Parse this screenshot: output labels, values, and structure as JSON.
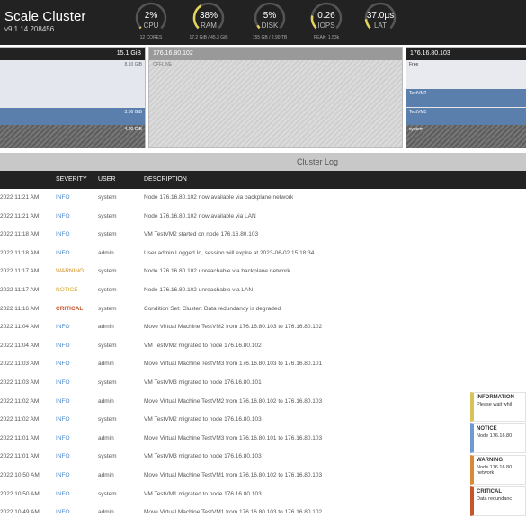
{
  "header": {
    "title": "Scale Cluster",
    "version": "v9.1.14.208456"
  },
  "gauges": [
    {
      "value": "2%",
      "label": "CPU",
      "sub": "12 CORES",
      "fraction": 0.02
    },
    {
      "value": "38%",
      "label": "RAM",
      "sub": "17.2 GiB / 45.3 GiB",
      "fraction": 0.38
    },
    {
      "value": "5%",
      "label": "DISK",
      "sub": "155 GB / 2.90 TB",
      "fraction": 0.05
    },
    {
      "value": "0.26",
      "label": "IOPS",
      "sub": "PEAK: 1.53k",
      "fraction": 0.2
    },
    {
      "value": "37.0µs",
      "label": "LAT",
      "sub": "",
      "fraction": 0.15
    }
  ],
  "nodes": {
    "left": {
      "total": "15.1 GiB",
      "free": "8.10 GiB",
      "vm": "3.00 GiB",
      "system": "4.00 GiB"
    },
    "middle": {
      "ip": "176.16.80.102",
      "status": "OFFLINE"
    },
    "right": {
      "ip": "176.16.80.103",
      "free_label": "Free",
      "vm2": "TestVM2",
      "vm1": "TestVM1",
      "system": "system"
    }
  },
  "log": {
    "title": "Cluster Log",
    "columns": {
      "severity": "SEVERITY",
      "user": "USER",
      "description": "DESCRIPTION"
    },
    "rows": [
      {
        "time": "2022 11:21 AM",
        "severity": "INFO",
        "user": "system",
        "desc": "Node 176.16.80.102 now available via backplane network"
      },
      {
        "time": "2022 11:21 AM",
        "severity": "INFO",
        "user": "system",
        "desc": "Node 176.16.80.102 now available via LAN"
      },
      {
        "time": "2022 11:18 AM",
        "severity": "INFO",
        "user": "system",
        "desc": "VM TestVM2 started on node 176.16.80.103"
      },
      {
        "time": "2022 11:18 AM",
        "severity": "INFO",
        "user": "admin",
        "desc": "User admin Logged In, session will expire at 2023-06-02 15:18:34"
      },
      {
        "time": "2022 11:17 AM",
        "severity": "WARNING",
        "user": "system",
        "desc": "Node 176.16.80.102 unreachable via backplane network"
      },
      {
        "time": "2022 11:17 AM",
        "severity": "NOTICE",
        "user": "system",
        "desc": "Node 176.16.80.102 unreachable via LAN"
      },
      {
        "time": "2022 11:16 AM",
        "severity": "CRITICAL",
        "user": "system",
        "desc": "Condition Set: Cluster: Data redundancy is degraded"
      },
      {
        "time": "2022 11:04 AM",
        "severity": "INFO",
        "user": "admin",
        "desc": "Move Virtual Machine TestVM2 from 176.16.80.103 to 176.16.80.102"
      },
      {
        "time": "2022 11:04 AM",
        "severity": "INFO",
        "user": "system",
        "desc": "VM TestVM2 migrated to node 176.16.80.102"
      },
      {
        "time": "2022 11:03 AM",
        "severity": "INFO",
        "user": "admin",
        "desc": "Move Virtual Machine TestVM3 from 176.16.80.103 to 176.16.80.101"
      },
      {
        "time": "2022 11:03 AM",
        "severity": "INFO",
        "user": "system",
        "desc": "VM TestVM3 migrated to node 176.16.80.101"
      },
      {
        "time": "2022 11:02 AM",
        "severity": "INFO",
        "user": "admin",
        "desc": "Move Virtual Machine TestVM2 from 176.16.80.102 to 176.16.80.103"
      },
      {
        "time": "2022 11:02 AM",
        "severity": "INFO",
        "user": "system",
        "desc": "VM TestVM2 migrated to node 176.16.80.103"
      },
      {
        "time": "2022 11:01 AM",
        "severity": "INFO",
        "user": "admin",
        "desc": "Move Virtual Machine TestVM3 from 176.16.80.101 to 176.16.80.103"
      },
      {
        "time": "2022 11:01 AM",
        "severity": "INFO",
        "user": "system",
        "desc": "VM TestVM3 migrated to node 176.16.80.103"
      },
      {
        "time": "2022 10:50 AM",
        "severity": "INFO",
        "user": "admin",
        "desc": "Move Virtual Machine TestVM1 from 176.16.80.102 to 176.16.80.103"
      },
      {
        "time": "2022 10:50 AM",
        "severity": "INFO",
        "user": "system",
        "desc": "VM TestVM1 migrated to node 176.16.80.103"
      },
      {
        "time": "2022 10:49 AM",
        "severity": "INFO",
        "user": "admin",
        "desc": "Move Virtual Machine TestVM1 from 176.16.80.103 to 176.16.80.102"
      }
    ]
  },
  "legend": [
    {
      "title": "INFORMATION",
      "text": "Please wait whil"
    },
    {
      "title": "NOTICE",
      "text": "Node 176.16.80"
    },
    {
      "title": "WARNING",
      "text": "Node 176.16.80 network"
    },
    {
      "title": "CRITICAL",
      "text": "Data redundanc"
    }
  ],
  "colors": {
    "header_bg": "#222222",
    "gauge_track": "#555555",
    "gauge_fill": "#e3d35a",
    "vm_blue": "#5b7fad",
    "info": "#4a88c7",
    "warning": "#d08a1a",
    "notice": "#d3a52a",
    "critical": "#c4572a"
  }
}
